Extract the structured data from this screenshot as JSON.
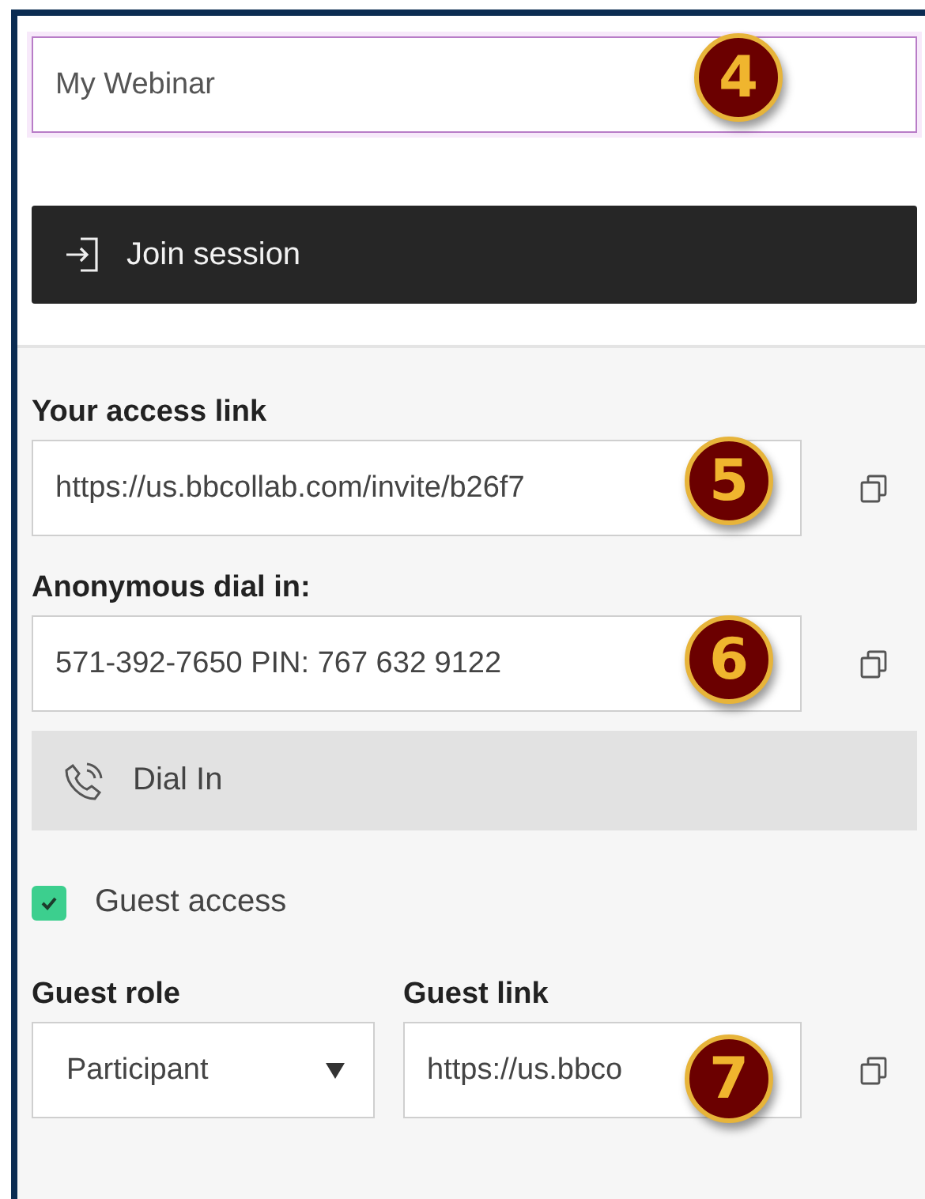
{
  "title_field": {
    "value": "My Webinar",
    "callout": "4"
  },
  "join_button": {
    "label": "Join session"
  },
  "access_link": {
    "label": "Your access link",
    "value": "https://us.bbcollab.com/invite/b26f7",
    "callout": "5"
  },
  "dial_in": {
    "label": "Anonymous dial in:",
    "value": "571-392-7650 PIN: 767 632 9122",
    "callout": "6"
  },
  "dial_button": {
    "label": "Dial In"
  },
  "guest_access": {
    "label": "Guest access",
    "checked": true
  },
  "guest_role": {
    "label": "Guest role",
    "value": "Participant"
  },
  "guest_link": {
    "label": "Guest link",
    "value": "https://us.bbco",
    "callout": "7"
  }
}
